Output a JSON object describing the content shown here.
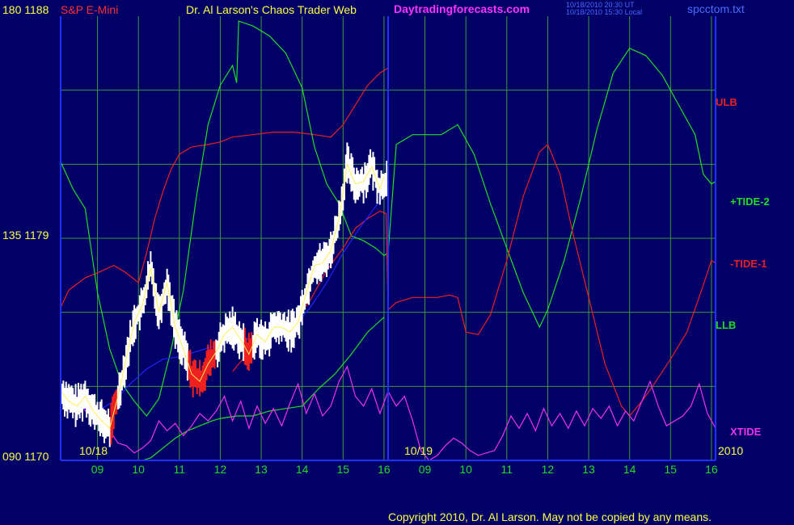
{
  "header": {
    "scale_top": "180 1188",
    "instrument": "S&P E-Mini",
    "title": "Dr. Al Larson's Chaos Trader Web",
    "site": "Daytradingforecasts.com",
    "timestamp_ut": "10/18/2010 20:30 UT",
    "timestamp_local": "10/18/2010 15:30 Local",
    "file": "spcctom.txt"
  },
  "scale": {
    "mid": "135 1179",
    "bottom": "090 1170",
    "year": "2010"
  },
  "dates": {
    "day1": "10/18",
    "day2": "10/19"
  },
  "footer": {
    "copyright": "Copyright 2010, Dr. Al Larson. May not be copied by any means."
  },
  "colors": {
    "background": "#000066",
    "grid": "#3a9a3a",
    "axis": "#2030ff",
    "ulb": "#e82020",
    "tide2": "#22dd22",
    "tide1": "#e82020",
    "llb": "#22dd22",
    "xtide": "#ee33ee",
    "price": "#ffffff",
    "price_down": "#ee2020",
    "avg": "#2222ff"
  },
  "chart_data": {
    "type": "line",
    "x_unit": "hour of session",
    "x_ticks": [
      {
        "x": 9,
        "label": "09"
      },
      {
        "x": 10,
        "label": "10"
      },
      {
        "x": 11,
        "label": "11"
      },
      {
        "x": 12,
        "label": "12"
      },
      {
        "x": 13,
        "label": "13"
      },
      {
        "x": 14,
        "label": "14"
      },
      {
        "x": 15,
        "label": "15"
      },
      {
        "x": 16,
        "label": "16"
      },
      {
        "x": 17,
        "label": "09"
      },
      {
        "x": 18,
        "label": "10"
      },
      {
        "x": 19,
        "label": "11"
      },
      {
        "x": 20,
        "label": "12"
      },
      {
        "x": 21,
        "label": "13"
      },
      {
        "x": 22,
        "label": "14"
      },
      {
        "x": 23,
        "label": "15"
      },
      {
        "x": 24,
        "label": "16"
      }
    ],
    "xlim": [
      8.1,
      24.1
    ],
    "ylim": [
      1170,
      1188
    ],
    "y_labels_left": {
      "1188": "180",
      "1179": "135",
      "1170": "090"
    },
    "series": [
      {
        "name": "ULB",
        "key": "ulb",
        "x": [
          8.1,
          8.3,
          8.7,
          9.0,
          9.4,
          9.7,
          10.0,
          10.2,
          10.4,
          10.6,
          10.8,
          11.0,
          11.3,
          11.7,
          12.0,
          12.3,
          12.8,
          13.3,
          13.8,
          14.3,
          14.7,
          15.0,
          15.3,
          15.6,
          15.9,
          16.1
        ],
        "y": [
          1176.2,
          1176.9,
          1177.4,
          1177.6,
          1177.9,
          1177.6,
          1177.2,
          1178.4,
          1179.8,
          1180.9,
          1181.8,
          1182.4,
          1182.7,
          1182.8,
          1182.9,
          1183.1,
          1183.2,
          1183.3,
          1183.3,
          1183.2,
          1183.1,
          1183.6,
          1184.4,
          1185.2,
          1185.7,
          1185.9
        ]
      },
      {
        "name": "+TIDE-2",
        "key": "tide2",
        "x": [
          8.1,
          8.4,
          8.7,
          9.0,
          9.3,
          9.6,
          9.9,
          10.2,
          10.5,
          10.8,
          11.1,
          11.4,
          11.7,
          12.0,
          12.3,
          12.4,
          12.45,
          12.8,
          13.2,
          13.6,
          14.0,
          14.3,
          14.6,
          14.9,
          15.2,
          15.5,
          15.8,
          16.0,
          16.1,
          16.3,
          16.7,
          17.0,
          17.4,
          17.8,
          18.2,
          18.6,
          19.0,
          19.4,
          19.8,
          20.0,
          20.4,
          20.8,
          21.2,
          21.6,
          22.0,
          22.4,
          22.8,
          23.2,
          23.6,
          23.8,
          24.0,
          24.1
        ],
        "y": [
          1182.1,
          1181.0,
          1180.2,
          1176.8,
          1174.5,
          1173.1,
          1172.4,
          1171.8,
          1172.5,
          1174.5,
          1176.9,
          1180.5,
          1183.6,
          1185.2,
          1186.0,
          1185.3,
          1187.8,
          1187.6,
          1187.2,
          1186.5,
          1185.1,
          1182.7,
          1181.2,
          1180.4,
          1179.1,
          1178.9,
          1178.6,
          1178.3,
          1178.4,
          1182.8,
          1183.2,
          1183.2,
          1183.2,
          1183.6,
          1182.4,
          1180.4,
          1178.6,
          1176.8,
          1175.4,
          1176.1,
          1178.1,
          1180.6,
          1183.4,
          1185.7,
          1186.7,
          1186.4,
          1185.6,
          1184.4,
          1183.2,
          1181.6,
          1181.2,
          1181.3
        ]
      },
      {
        "name": "-TIDE-1",
        "key": "tide1",
        "x": [
          12.3,
          12.6,
          13.0,
          13.4,
          13.8,
          14.2,
          14.6,
          15.0,
          15.3,
          15.6,
          15.9,
          16.05,
          16.1,
          16.3,
          16.7,
          17.0,
          17.3,
          17.6,
          17.8,
          18.0,
          18.3,
          18.6,
          19.0,
          19.4,
          19.8,
          20.0,
          20.3,
          20.6,
          21.0,
          21.4,
          21.8,
          22.0,
          22.3,
          22.6,
          23.0,
          23.4,
          23.8,
          24.0,
          24.1
        ],
        "y": [
          1173.6,
          1174.2,
          1175.0,
          1175.3,
          1175.6,
          1176.5,
          1177.7,
          1178.6,
          1179.4,
          1179.8,
          1180.1,
          1180.0,
          1176.1,
          1176.4,
          1176.6,
          1176.6,
          1176.6,
          1176.7,
          1176.6,
          1175.2,
          1175.1,
          1175.9,
          1178.1,
          1180.7,
          1182.5,
          1182.8,
          1181.6,
          1179.3,
          1176.6,
          1173.9,
          1172.2,
          1171.8,
          1172.4,
          1173.1,
          1174.1,
          1175.2,
          1177.1,
          1178.1,
          1178.0
        ]
      },
      {
        "name": "LLB",
        "key": "llb",
        "x": [
          10.1,
          10.3,
          10.6,
          10.9,
          11.2,
          11.5,
          11.8,
          12.0,
          12.4,
          12.8,
          13.2,
          13.6,
          14.0,
          14.4,
          14.8,
          15.2,
          15.6,
          16.0
        ],
        "y": [
          1170.0,
          1170.1,
          1170.5,
          1170.9,
          1171.2,
          1171.4,
          1171.6,
          1171.7,
          1171.8,
          1171.8,
          1172.0,
          1172.1,
          1172.2,
          1172.9,
          1173.5,
          1174.3,
          1175.2,
          1175.8
        ]
      },
      {
        "name": "XTIDE",
        "key": "xtide",
        "x": [
          8.1,
          8.3,
          8.5,
          8.7,
          8.9,
          9.1,
          9.3,
          9.5,
          9.7,
          9.9,
          10.1,
          10.3,
          10.5,
          10.7,
          10.9,
          11.1,
          11.3,
          11.5,
          11.7,
          11.9,
          12.1,
          12.3,
          12.5,
          12.7,
          12.9,
          13.1,
          13.3,
          13.5,
          13.7,
          13.9,
          14.1,
          14.3,
          14.5,
          14.7,
          14.9,
          15.1,
          15.3,
          15.5,
          15.7,
          15.9,
          16.1,
          16.3,
          16.5,
          16.7,
          16.9,
          17.1,
          17.3,
          17.5,
          17.7,
          17.9,
          18.1,
          18.3,
          18.5,
          18.7,
          18.9,
          19.1,
          19.3,
          19.5,
          19.7,
          19.9,
          20.1,
          20.3,
          20.5,
          20.7,
          20.9,
          21.1,
          21.3,
          21.5,
          21.7,
          21.9,
          22.1,
          22.3,
          22.5,
          22.7,
          22.9,
          23.1,
          23.3,
          23.5,
          23.7,
          23.9,
          24.1
        ],
        "y": [
          1172.6,
          1172.4,
          1172.5,
          1172.0,
          1172.0,
          1171.4,
          1171.2,
          1170.7,
          1170.6,
          1170.3,
          1170.5,
          1170.8,
          1171.6,
          1171.2,
          1171.5,
          1171.0,
          1171.4,
          1171.9,
          1171.6,
          1172.0,
          1172.6,
          1171.6,
          1172.4,
          1171.3,
          1172.2,
          1171.5,
          1172.1,
          1171.4,
          1172.3,
          1173.1,
          1171.9,
          1172.7,
          1171.8,
          1172.2,
          1173.2,
          1173.8,
          1172.6,
          1172.2,
          1172.9,
          1171.9,
          1172.8,
          1172.2,
          1172.6,
          1171.6,
          1170.4,
          1170.0,
          1170.2,
          1170.6,
          1170.9,
          1170.7,
          1170.4,
          1170.2,
          1170.3,
          1170.4,
          1171.0,
          1171.8,
          1171.3,
          1171.9,
          1171.2,
          1172.1,
          1171.4,
          1171.9,
          1171.3,
          1172.0,
          1171.4,
          1172.1,
          1171.7,
          1172.2,
          1171.4,
          1172.0,
          1171.6,
          1172.4,
          1173.2,
          1172.2,
          1171.4,
          1171.6,
          1171.8,
          1172.2,
          1173.1,
          1171.9,
          1171.3
        ]
      },
      {
        "name": "price",
        "key": "price",
        "x": [
          8.1,
          8.3,
          8.5,
          8.7,
          8.9,
          9.1,
          9.3,
          9.5,
          9.7,
          9.9,
          10.1,
          10.3,
          10.5,
          10.7,
          10.9,
          11.1,
          11.3,
          11.5,
          11.7,
          11.9,
          12.1,
          12.3,
          12.5,
          12.7,
          12.9,
          13.1,
          13.3,
          13.5,
          13.7,
          13.9,
          14.1,
          14.3,
          14.5,
          14.7,
          14.9,
          15.1,
          15.3,
          15.5,
          15.7,
          15.9,
          16.0
        ],
        "y": [
          1172.8,
          1172.4,
          1172.2,
          1172.6,
          1172.0,
          1171.6,
          1171.3,
          1172.6,
          1174.1,
          1175.6,
          1176.3,
          1177.8,
          1176.0,
          1177.2,
          1175.4,
          1174.5,
          1173.5,
          1173.2,
          1173.9,
          1174.4,
          1175.1,
          1175.4,
          1174.9,
          1174.3,
          1175.1,
          1174.8,
          1175.4,
          1175.4,
          1175.2,
          1175.6,
          1176.8,
          1177.9,
          1178.0,
          1178.5,
          1179.8,
          1182.0,
          1181.2,
          1181.3,
          1181.9,
          1181.0,
          1181.5
        ]
      },
      {
        "name": "average",
        "key": "avg",
        "x": [
          8.1,
          8.6,
          9.0,
          9.4,
          9.8,
          10.2,
          10.6,
          11.0,
          11.4,
          11.8,
          12.2,
          12.6,
          13.0,
          13.4,
          13.8,
          14.2,
          14.6,
          15.0,
          15.4,
          15.8,
          16.0
        ],
        "y": [
          1172.4,
          1172.1,
          1172.0,
          1172.4,
          1173.1,
          1173.7,
          1174.1,
          1174.2,
          1174.4,
          1174.6,
          1174.8,
          1174.9,
          1175.0,
          1175.2,
          1175.4,
          1176.2,
          1177.2,
          1178.4,
          1179.4,
          1180.3,
          1180.7
        ]
      }
    ],
    "line_labels": [
      {
        "series": "ULB",
        "text": "ULB"
      },
      {
        "series": "+TIDE-2",
        "text": "+TIDE-2"
      },
      {
        "series": "-TIDE-1",
        "text": "-TIDE-1"
      },
      {
        "series": "LLB",
        "text": "LLB"
      },
      {
        "series": "XTIDE",
        "text": "XTIDE"
      }
    ],
    "grid": true
  }
}
